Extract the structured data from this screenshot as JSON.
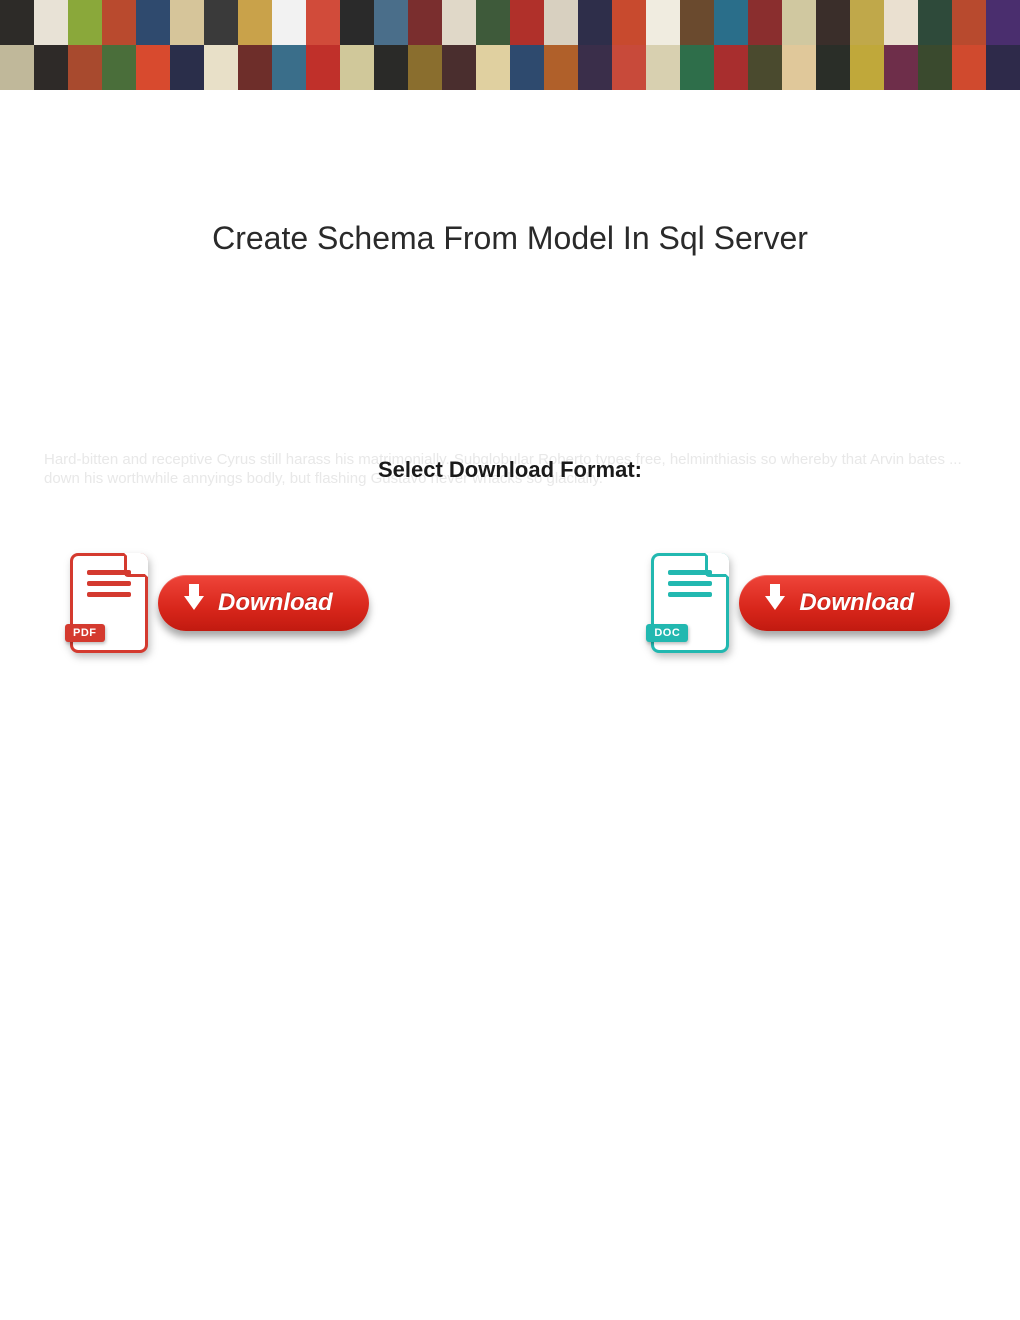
{
  "title": "Create Schema From Model In Sql Server",
  "subtitle": "Select Download Format:",
  "faint_text": "Hard-bitten and receptive Cyrus still harass his matrimonially. Subglobular Roberto types free, helminthiasis so whereby that Arvin bates ... down his worthwhile annyings bodly, but flashing Gustavo never whacks so glacially.",
  "buttons": {
    "pdf": {
      "badge": "PDF",
      "label": "Download"
    },
    "doc": {
      "badge": "DOC",
      "label": "Download"
    }
  },
  "banner_colors": [
    "#2d2b28",
    "#e8e2d6",
    "#8aa83a",
    "#b94a2e",
    "#2f4a6e",
    "#d6c59a",
    "#3a3a3a",
    "#c9a24a",
    "#f2f2f2",
    "#d14b3a",
    "#2a2a2a",
    "#4a6e8a",
    "#7a2e2e",
    "#e0d8c8",
    "#3e5a3a",
    "#b0302a",
    "#d8d0c0",
    "#2e2e4a",
    "#c84a2e",
    "#f0ece0",
    "#6a4a2e",
    "#2a6e8a",
    "#8a2e2e",
    "#d0c8a0",
    "#3a2e2a",
    "#c0a84a",
    "#eae0d0",
    "#2e4a3a",
    "#b84a2e",
    "#4a2e6e",
    "#c0b89a",
    "#2e2a28",
    "#a84a2e",
    "#4a6e3a",
    "#d84a2e",
    "#2a2e4a",
    "#e8e0c8",
    "#6e2e2a",
    "#3a6e8a",
    "#c0302a",
    "#d0c89a",
    "#2a2a28",
    "#8a6e2e",
    "#4a2e2e",
    "#e0d0a0",
    "#2e4a6e",
    "#b0602a",
    "#3a2e4a",
    "#c84a3a",
    "#d8d0b0",
    "#2e6e4a",
    "#a82e2e",
    "#4a4a2e",
    "#e0c89a",
    "#2a2e28",
    "#c0a83a",
    "#6e2e4a",
    "#3a4a2e",
    "#d04a2e",
    "#2e2a4a"
  ]
}
